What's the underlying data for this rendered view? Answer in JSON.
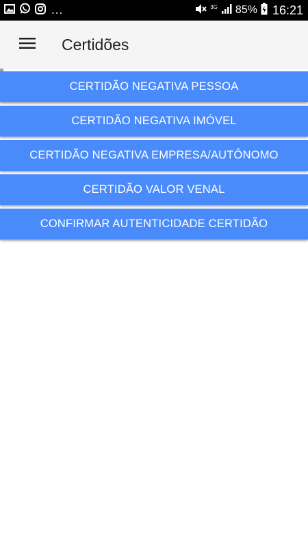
{
  "status_bar": {
    "dots": "...",
    "network_label": "3G",
    "battery_percent": "85%",
    "time": "16:21",
    "icons": [
      "image-icon",
      "whatsapp-icon",
      "instagram-icon",
      "mute-icon",
      "signal-icon",
      "battery-icon"
    ]
  },
  "app_bar": {
    "title": "Certidões",
    "menu_icon": "hamburger-menu-icon"
  },
  "buttons": [
    {
      "label": "CERTIDÃO NEGATIVA PESSOA"
    },
    {
      "label": "CERTIDÃO NEGATIVA IMÓVEL"
    },
    {
      "label": "CERTIDÃO NEGATIVA EMPRESA/AUTÔNOMO"
    },
    {
      "label": "CERTIDÃO VALOR VENAL"
    },
    {
      "label": "CONFIRMAR AUTENTICIDADE CERTIDÃO"
    }
  ],
  "colors": {
    "button_bg": "#4a8bfc",
    "app_bar_bg": "#f5f5f5",
    "status_bar_bg": "#000000"
  }
}
